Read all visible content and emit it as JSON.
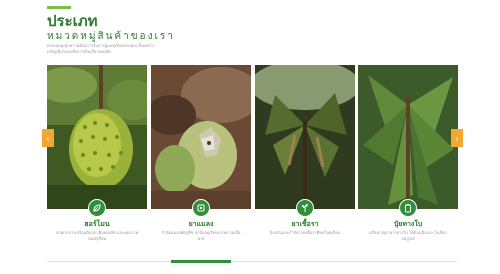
{
  "section": {
    "title": "ประเภท",
    "subtitle": "หมวดหมู่สินค้าของเรา",
    "description": "ครอบคลุมทุกความต้องการในการดูแลทุเรียนของคุณ ตั้งแต่การเจริญเติบโตจนถึงการเก็บเกี่ยวผลผลิต"
  },
  "categories": [
    {
      "label": "ฮอร์โมน",
      "description": "ช่วยเร่งการเจริญเติบโต เพิ่มผลผลิต และคุณภาพของทุเรียน",
      "icon": "leaf-icon"
    },
    {
      "label": "ยาแมลง",
      "description": "กำจัดแมลงศัตรูพืช ปกป้องทุเรียนจากความเสียหาย",
      "icon": "bug-icon"
    },
    {
      "label": "ยาเชื้อรา",
      "description": "ป้องกันและกำจัดโรคเชื้อราที่พบในทุเรียน",
      "icon": "sprout-icon"
    },
    {
      "label": "ปุ๋ยทางใบ",
      "description": "เสริมธาตุอาหารทางใบ ให้ต้นแข็งแรง ใบเขียวสมบูรณ์",
      "icon": "fertilizer-icon"
    }
  ],
  "navigation": {
    "prev_icon": "‹",
    "next_icon": "›"
  },
  "colors": {
    "primary": "#2d7a2f",
    "accent": "#7bbf3f",
    "nav": "#f2a733",
    "muted": "#9a9a9a"
  }
}
